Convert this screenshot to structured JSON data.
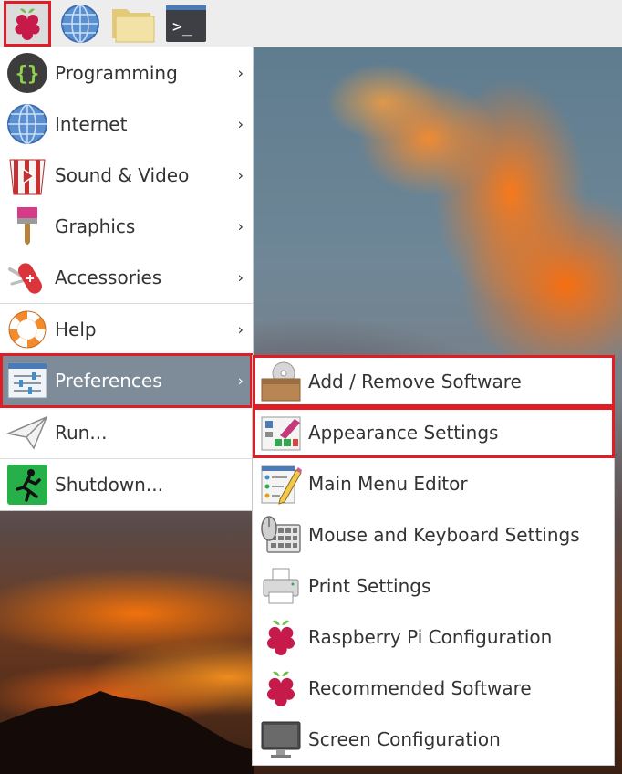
{
  "taskbar": {
    "buttons": [
      {
        "name": "raspberry-menu",
        "icon": "raspberry-icon",
        "highlighted": true
      },
      {
        "name": "web-browser",
        "icon": "globe-icon"
      },
      {
        "name": "file-manager",
        "icon": "folder-icon"
      },
      {
        "name": "terminal",
        "icon": "terminal-icon",
        "glyph": ">_"
      }
    ]
  },
  "menu": {
    "items": [
      {
        "label": "Programming",
        "icon": "braces-icon",
        "has_submenu": true
      },
      {
        "label": "Internet",
        "icon": "globe-icon",
        "has_submenu": true
      },
      {
        "label": "Sound & Video",
        "icon": "popcorn-video-icon",
        "has_submenu": true
      },
      {
        "label": "Graphics",
        "icon": "paintbrush-icon",
        "has_submenu": true
      },
      {
        "label": "Accessories",
        "icon": "swiss-knife-icon",
        "has_submenu": true
      },
      {
        "label": "Help",
        "icon": "lifebuoy-icon",
        "has_submenu": true
      },
      {
        "label": "Preferences",
        "icon": "settings-sliders-icon",
        "has_submenu": true,
        "active": true,
        "highlighted": true
      },
      {
        "label": "Run...",
        "icon": "paper-plane-icon",
        "has_submenu": false
      },
      {
        "label": "Shutdown...",
        "icon": "exit-runner-icon",
        "has_submenu": false
      }
    ],
    "arrow": "›"
  },
  "submenu": {
    "items": [
      {
        "label": "Add / Remove Software",
        "icon": "package-disc-icon",
        "highlighted": true
      },
      {
        "label": "Appearance Settings",
        "icon": "palette-swatch-icon",
        "highlighted": true
      },
      {
        "label": "Main Menu Editor",
        "icon": "menu-editor-pencil-icon"
      },
      {
        "label": "Mouse and Keyboard Settings",
        "icon": "mouse-keyboard-icon"
      },
      {
        "label": "Print Settings",
        "icon": "printer-icon"
      },
      {
        "label": "Raspberry Pi Configuration",
        "icon": "raspberry-icon"
      },
      {
        "label": "Recommended Software",
        "icon": "raspberry-icon"
      },
      {
        "label": "Screen Configuration",
        "icon": "monitor-icon"
      }
    ]
  },
  "colors": {
    "highlight_border": "#e01c24",
    "active_item_bg": "#7e8c99",
    "raspberry_red": "#c51a4a",
    "raspberry_leaf": "#6cc04a"
  }
}
